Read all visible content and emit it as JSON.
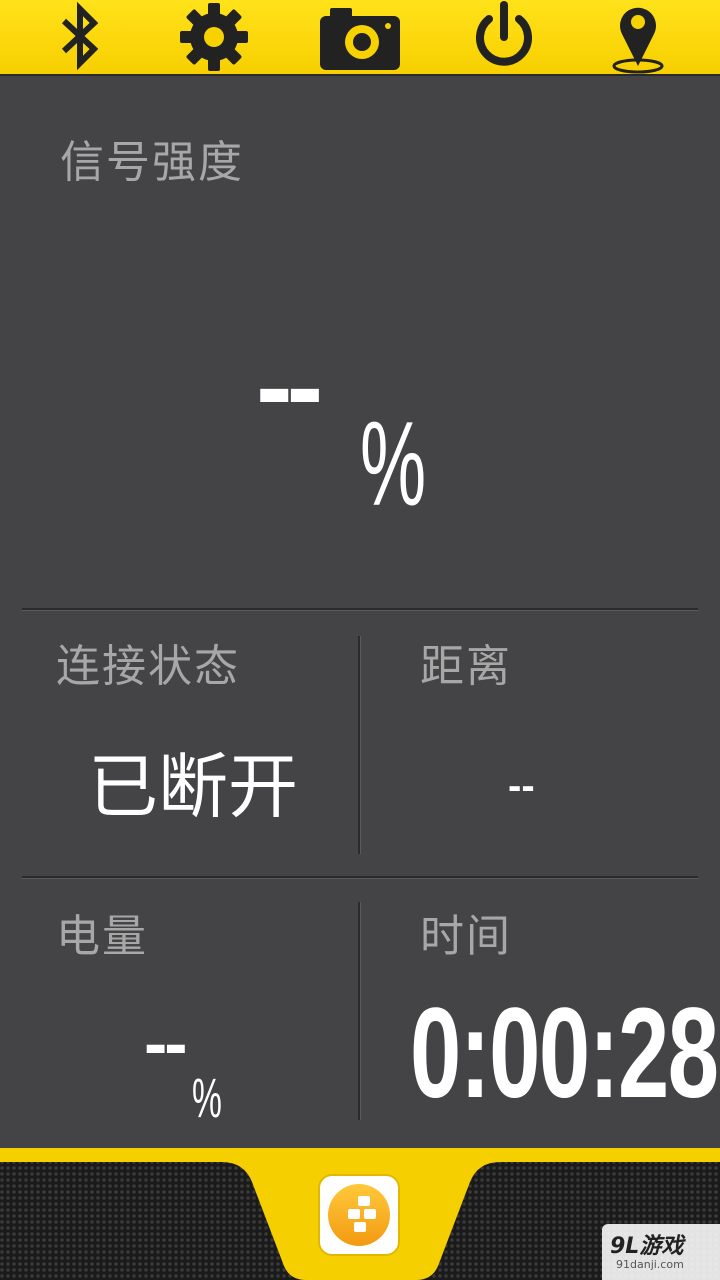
{
  "toolbar": {
    "icons": [
      "bluetooth-icon",
      "gear-icon",
      "camera-icon",
      "power-icon",
      "location-pin-icon"
    ]
  },
  "signal": {
    "label": "信号强度",
    "value": "--",
    "unit": "%"
  },
  "connection": {
    "label": "连接状态",
    "value": "已断开"
  },
  "distance": {
    "label": "距离",
    "value": "--"
  },
  "battery": {
    "label": "电量",
    "value": "--",
    "unit": "%"
  },
  "time": {
    "label": "时间",
    "value": "0:00:28"
  },
  "watermark": {
    "logo": "9L游戏",
    "url": "91danji.com"
  },
  "colors": {
    "accent": "#f6cf00",
    "background": "#444446",
    "label": "#a7a7a7"
  }
}
